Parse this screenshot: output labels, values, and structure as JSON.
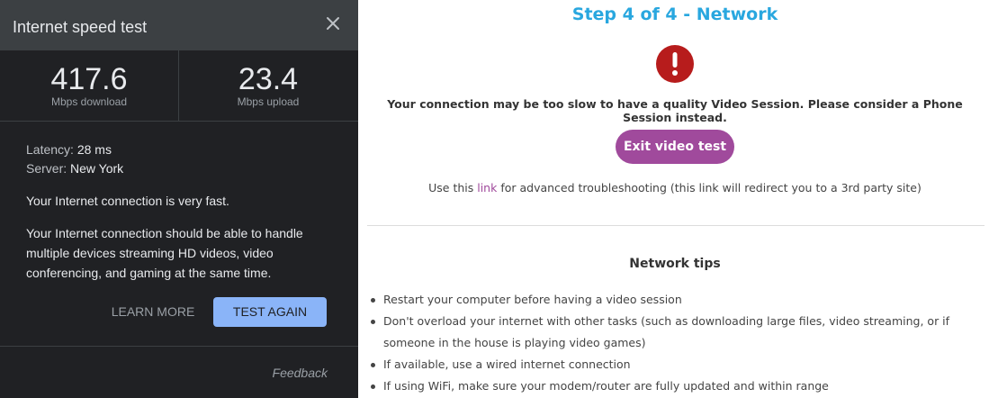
{
  "speed_panel": {
    "title": "Internet speed test",
    "download": {
      "value": "417.6",
      "unit": "Mbps download"
    },
    "upload": {
      "value": "23.4",
      "unit": "Mbps upload"
    },
    "latency_label": "Latency:",
    "latency_value": "28 ms",
    "server_label": "Server:",
    "server_value": "New York",
    "summary": "Your Internet connection is very fast.",
    "description": "Your Internet connection should be able to handle multiple devices streaming HD videos, video conferencing, and gaming at the same time.",
    "learn_more_label": "LEARN MORE",
    "test_again_label": "TEST AGAIN",
    "feedback_label": "Feedback",
    "icons": {
      "close": "close-icon"
    }
  },
  "network_step": {
    "title": "Step 4 of 4 - Network",
    "alert_icon": "alert-icon",
    "warning": "Your connection may be too slow to have a quality Video Session. Please consider a Phone Session instead.",
    "exit_button_label": "Exit video test",
    "troubleshoot_prefix": "Use this ",
    "troubleshoot_link": "link",
    "troubleshoot_suffix": " for advanced troubleshooting (this link will redirect you to a 3rd party site)",
    "tips_title": "Network tips",
    "tips": [
      "Restart your computer before having a video session",
      "Don't overload your internet with other tasks (such as downloading large files, video streaming, or if someone in the house is playing video games)",
      "If available, use a wired internet connection",
      "If using WiFi, make sure your modem/router are fully updated and within range"
    ]
  },
  "colors": {
    "panel_bg": "#202124",
    "panel_header_bg": "#3c4043",
    "test_again_bg": "#8ab4f8",
    "step_title": "#29a7df",
    "alert_red": "#b71c1c",
    "exit_button_bg": "#a04a9c"
  }
}
